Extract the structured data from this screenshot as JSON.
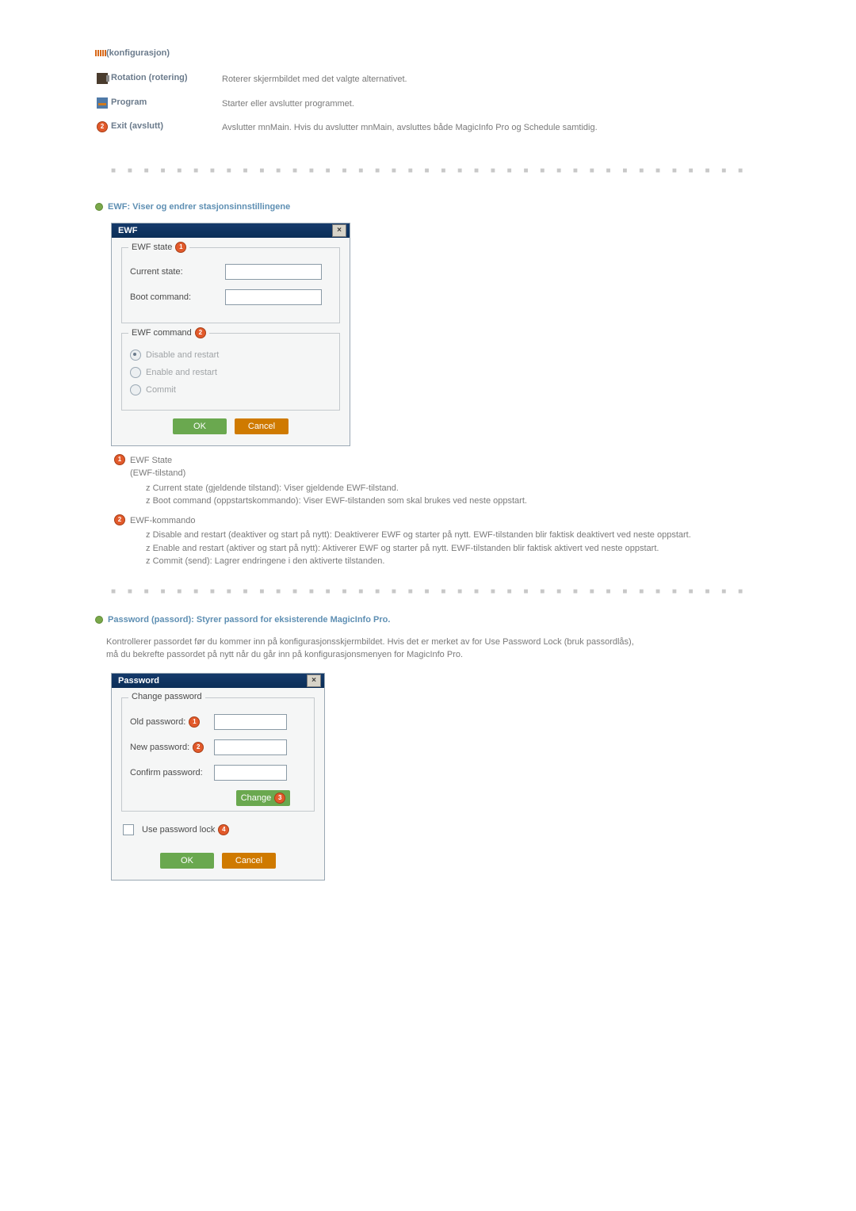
{
  "config_section": {
    "title": "(konfigurasjon)",
    "items": [
      {
        "label": "Rotation (rotering)",
        "desc": "Roterer skjermbildet med det valgte alternativet."
      },
      {
        "label": "Program",
        "desc": "Starter eller avslutter programmet."
      },
      {
        "label": "Exit (avslutt)",
        "desc": "Avslutter mnMain. Hvis du avslutter mnMain, avsluttes både MagicInfo Pro og Schedule samtidig."
      }
    ],
    "exit_badge": "2"
  },
  "ewf": {
    "heading": "EWF: Viser og endrer stasjonsinnstillingene",
    "dialog": {
      "title": "EWF",
      "group_state": {
        "legend": "EWF state",
        "badge": "1",
        "current_state_label": "Current state:",
        "boot_command_label": "Boot command:"
      },
      "group_cmd": {
        "legend": "EWF command",
        "badge": "2",
        "opt_disable": "Disable and restart",
        "opt_enable": "Enable and restart",
        "opt_commit": "Commit"
      },
      "ok": "OK",
      "cancel": "Cancel"
    },
    "explain": {
      "state_title": "EWF State",
      "state_sub": "(EWF-tilstand)",
      "state_items": [
        "Current state (gjeldende tilstand): Viser gjeldende EWF-tilstand.",
        "Boot command (oppstartskommando): Viser EWF-tilstanden som skal brukes ved neste oppstart."
      ],
      "cmd_title": "EWF-kommando",
      "cmd_items": [
        "Disable and restart (deaktiver og start på nytt): Deaktiverer EWF og starter på nytt. EWF-tilstanden blir faktisk deaktivert ved neste oppstart.",
        "Enable and restart (aktiver og start på nytt): Aktiverer EWF og starter på nytt. EWF-tilstanden blir faktisk aktivert ved neste oppstart.",
        "Commit (send): Lagrer endringene i den aktiverte tilstanden."
      ],
      "badge1": "1",
      "badge2": "2"
    }
  },
  "password": {
    "heading": "Password (passord): Styrer passord for eksisterende MagicInfo Pro.",
    "intro": "Kontrollerer passordet før du kommer inn på konfigurasjonsskjermbildet. Hvis det er merket av for Use Password Lock (bruk passordlås), må du bekrefte passordet på nytt når du går inn på konfigurasjonsmenyen for MagicInfo Pro.",
    "dialog": {
      "title": "Password",
      "group_legend": "Change password",
      "old_label": "Old password:",
      "old_badge": "1",
      "new_label": "New password:",
      "new_badge": "2",
      "confirm_label": "Confirm password:",
      "change_btn": "Change",
      "change_badge": "3",
      "lock_label": "Use password lock",
      "lock_badge": "4",
      "ok": "OK",
      "cancel": "Cancel"
    }
  }
}
